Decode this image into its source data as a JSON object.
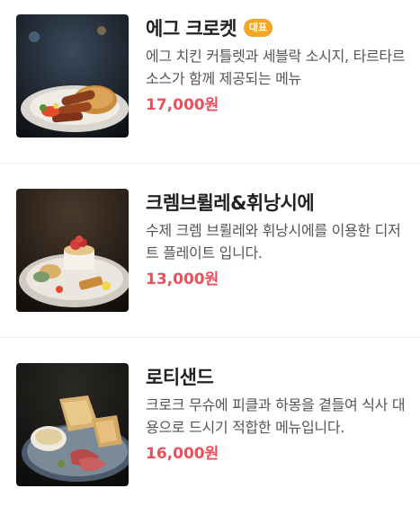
{
  "menu": {
    "items": [
      {
        "title": "에그 크로켓",
        "badge": "대표",
        "description": "에그 치킨 커틀렛과 세블락 소시지, 타르타르 소스가 함께 제공되는 메뉴",
        "price": "17,000원",
        "image": "egg-croquette-plate-photo"
      },
      {
        "title": "크렘브륄레&휘낭시에",
        "description": "수제 크렘 브륄레와 휘낭시에를 이용한 디저트 플레이트 입니다.",
        "price": "13,000원",
        "image": "dessert-plate-photo"
      },
      {
        "title": "로티샌드",
        "description": "크로크 무슈에 피클과 하몽을 곁들여 식사 대용으로 드시기 적합한 메뉴입니다.",
        "price": "16,000원",
        "image": "roti-sandwich-platter-photo"
      }
    ]
  },
  "colors": {
    "price": "#e8505b",
    "badge": "#f5a623",
    "title": "#222222",
    "description": "#555555"
  }
}
